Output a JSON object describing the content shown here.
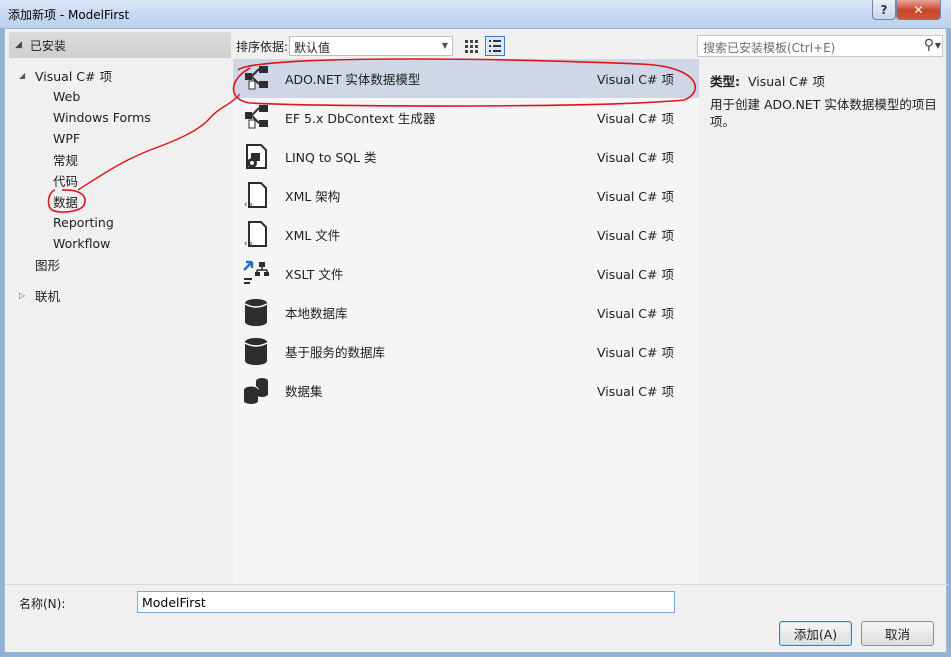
{
  "window": {
    "title": "添加新项 - ModelFirst",
    "help_label": "?",
    "close_label": "✕"
  },
  "left": {
    "header": "已安装",
    "tree": [
      {
        "label": "Visual C# 项",
        "level": 0,
        "expanded": true
      },
      {
        "label": "Web",
        "level": 1
      },
      {
        "label": "Windows Forms",
        "level": 1
      },
      {
        "label": "WPF",
        "level": 1
      },
      {
        "label": "常规",
        "level": 1
      },
      {
        "label": "代码",
        "level": 1
      },
      {
        "label": "数据",
        "level": 1,
        "selected": true
      },
      {
        "label": "Reporting",
        "level": 1
      },
      {
        "label": "Workflow",
        "level": 1
      },
      {
        "label": "图形",
        "level": 0
      },
      {
        "label": "联机",
        "level": 0,
        "collapsed": true
      }
    ]
  },
  "toolbar": {
    "sort_label": "排序依据:",
    "sort_value": "默认值"
  },
  "list": {
    "items": [
      {
        "name": "ADO.NET 实体数据模型",
        "lang": "Visual C# 项",
        "icon": "ado-entity-icon",
        "selected": true
      },
      {
        "name": "EF 5.x DbContext 生成器",
        "lang": "Visual C# 项",
        "icon": "ef-dbcontext-icon"
      },
      {
        "name": "LINQ to SQL 类",
        "lang": "Visual C# 项",
        "icon": "linq-sql-icon"
      },
      {
        "name": "XML 架构",
        "lang": "Visual C# 项",
        "icon": "xml-schema-icon"
      },
      {
        "name": "XML 文件",
        "lang": "Visual C# 项",
        "icon": "xml-file-icon"
      },
      {
        "name": "XSLT 文件",
        "lang": "Visual C# 项",
        "icon": "xslt-file-icon"
      },
      {
        "name": "本地数据库",
        "lang": "Visual C# 项",
        "icon": "database-icon"
      },
      {
        "name": "基于服务的数据库",
        "lang": "Visual C# 项",
        "icon": "database-icon"
      },
      {
        "name": "数据集",
        "lang": "Visual C# 项",
        "icon": "dataset-icon"
      }
    ]
  },
  "search": {
    "placeholder": "搜索已安装模板(Ctrl+E)"
  },
  "detail": {
    "type_label": "类型:",
    "type_value": "Visual C# 项",
    "description": "用于创建 ADO.NET 实体数据模型的项目项。"
  },
  "bottom": {
    "name_label": "名称(N):",
    "name_value": "ModelFirst",
    "add_label": "添加(A)",
    "cancel_label": "取消"
  },
  "colors": {
    "annotation": "#e0141c",
    "selection": "#cfd7e6",
    "titlebar": "#c3d7ef"
  }
}
